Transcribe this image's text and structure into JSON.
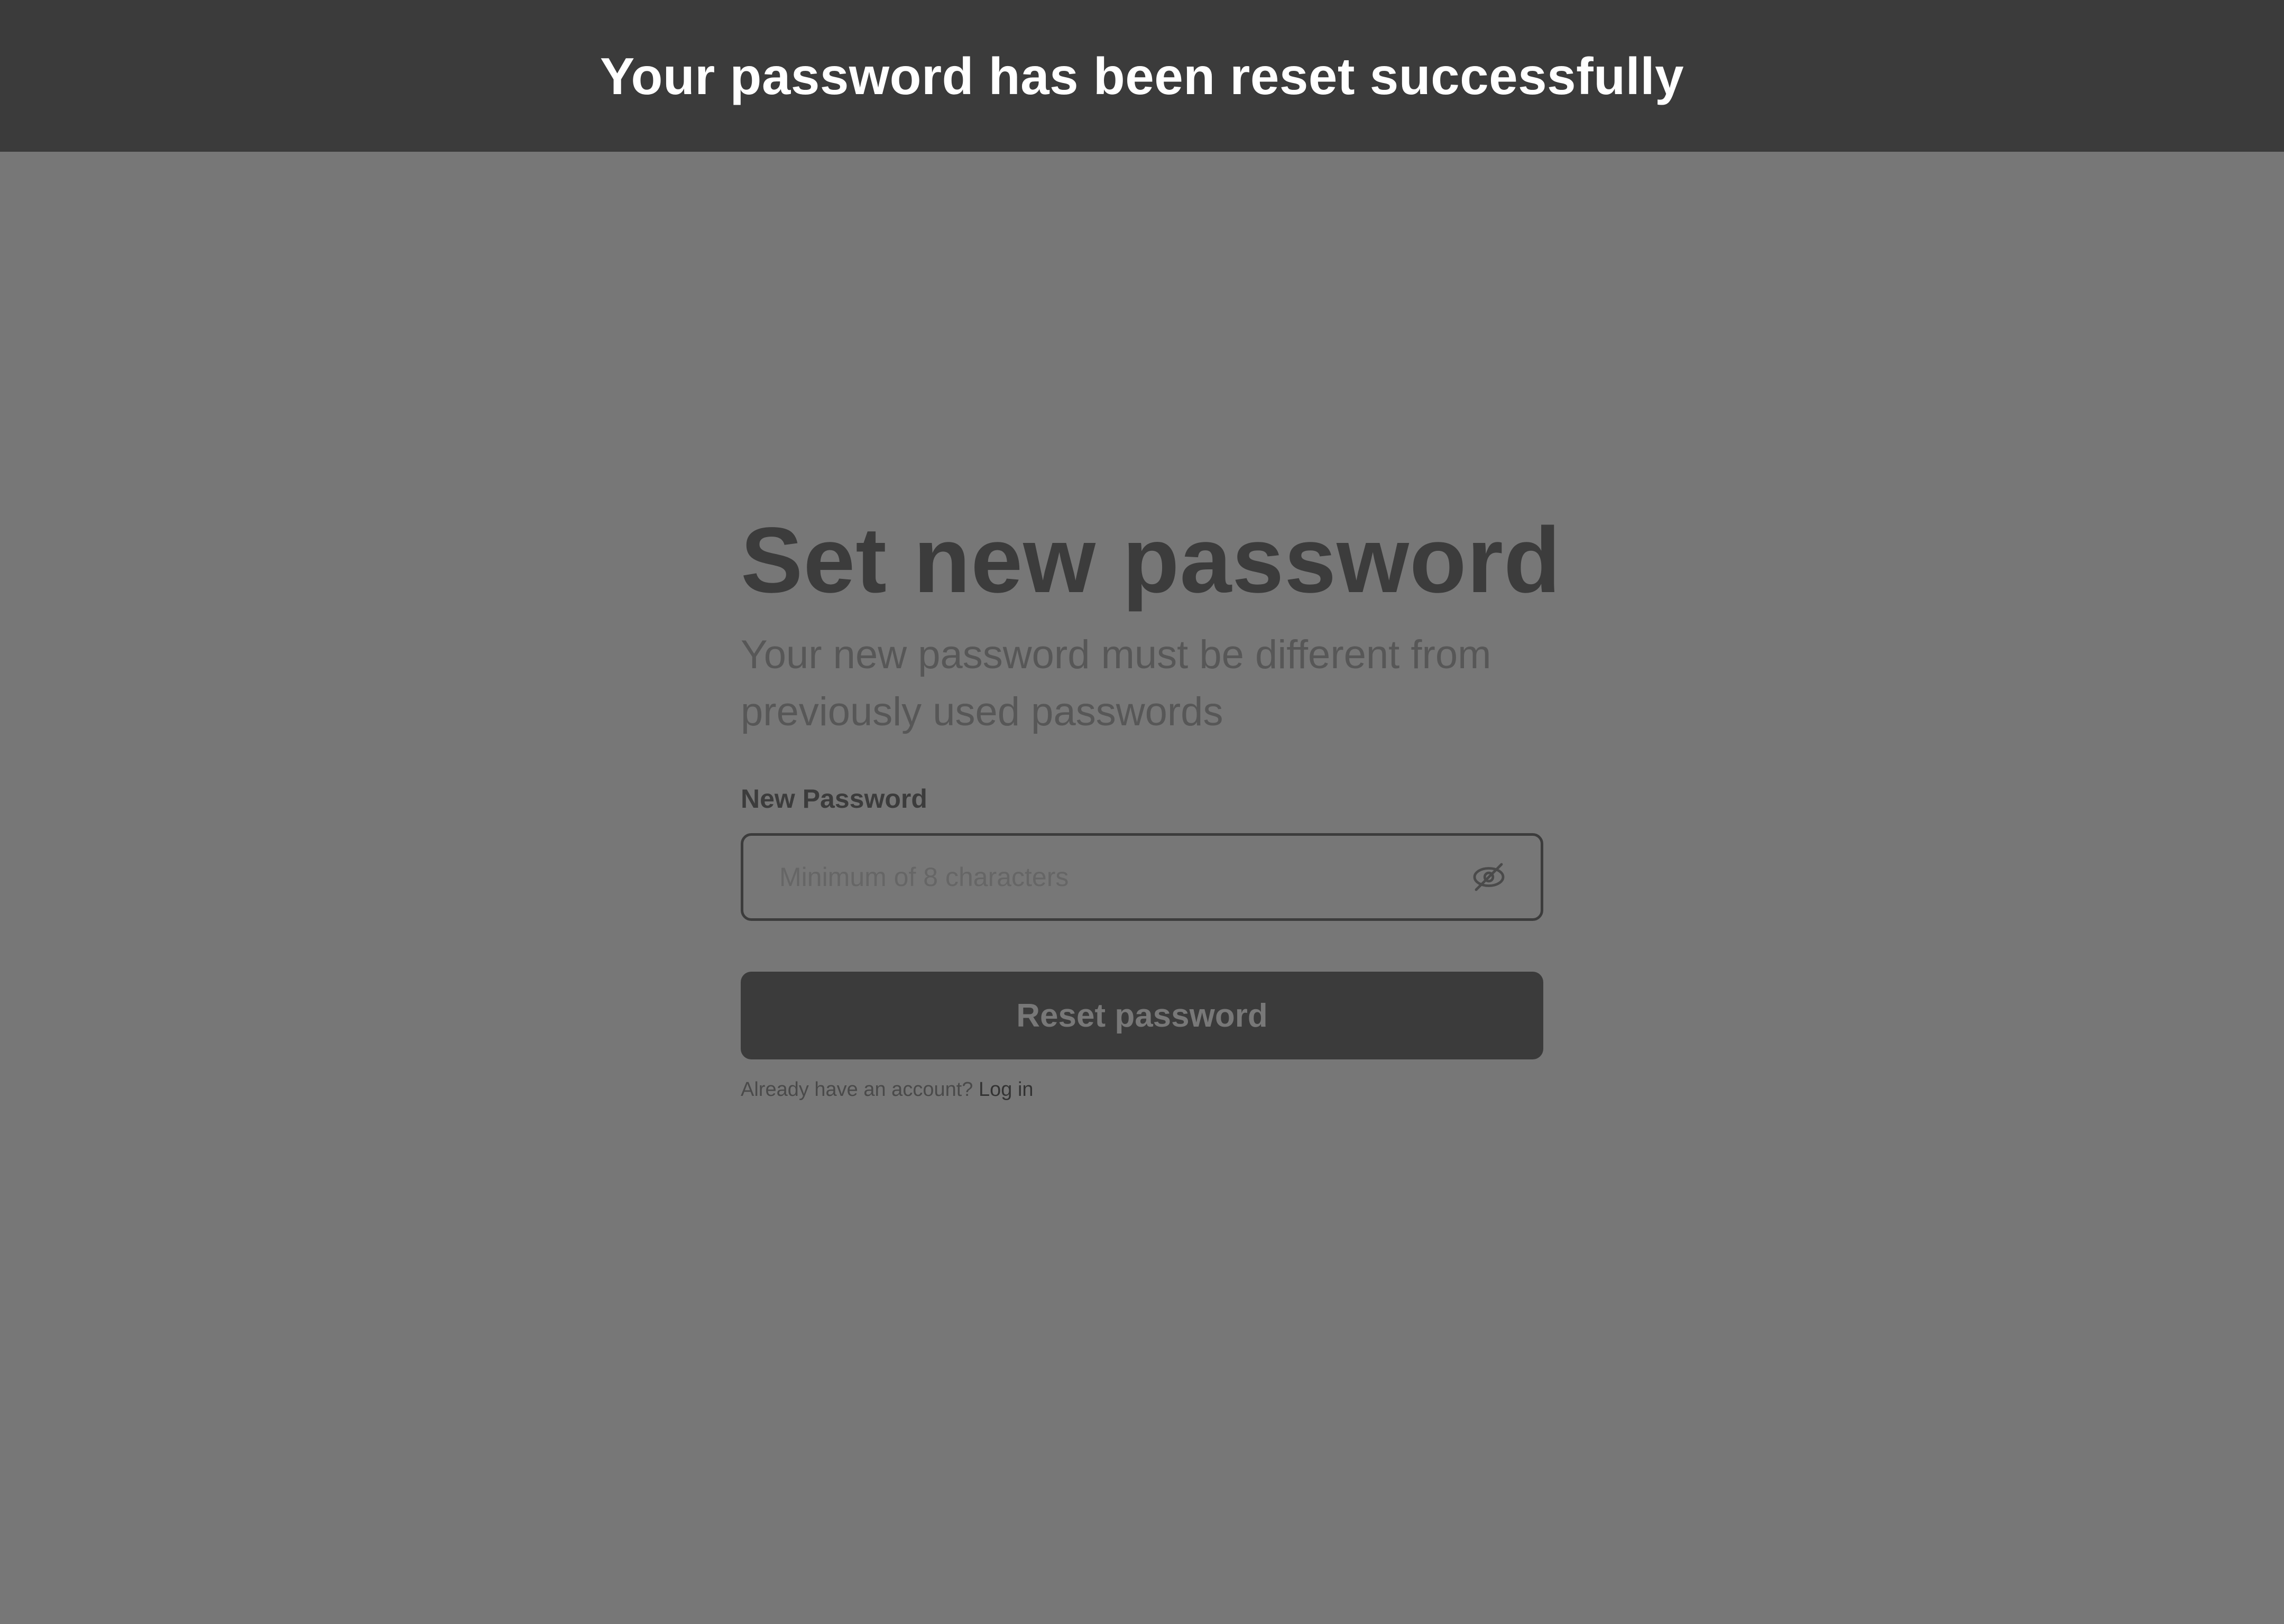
{
  "banner": {
    "message": "Your password has been reset successfully"
  },
  "form": {
    "title": "Set new password",
    "subtitle": "Your new password must be different from previously used passwords",
    "password_label": "New Password",
    "password_placeholder": "Minimum of 8 characters",
    "password_value": "",
    "toggle_icon": "eye-off-icon",
    "submit_label": "Reset password",
    "login_prompt": "Already have an account?",
    "login_link": "Log in"
  },
  "colors": {
    "overlay_background": "#777777",
    "banner_background": "#3b3b3b",
    "banner_text": "#ffffff",
    "heading_text": "#3c3c3c",
    "button_background": "#3b3b3b"
  }
}
